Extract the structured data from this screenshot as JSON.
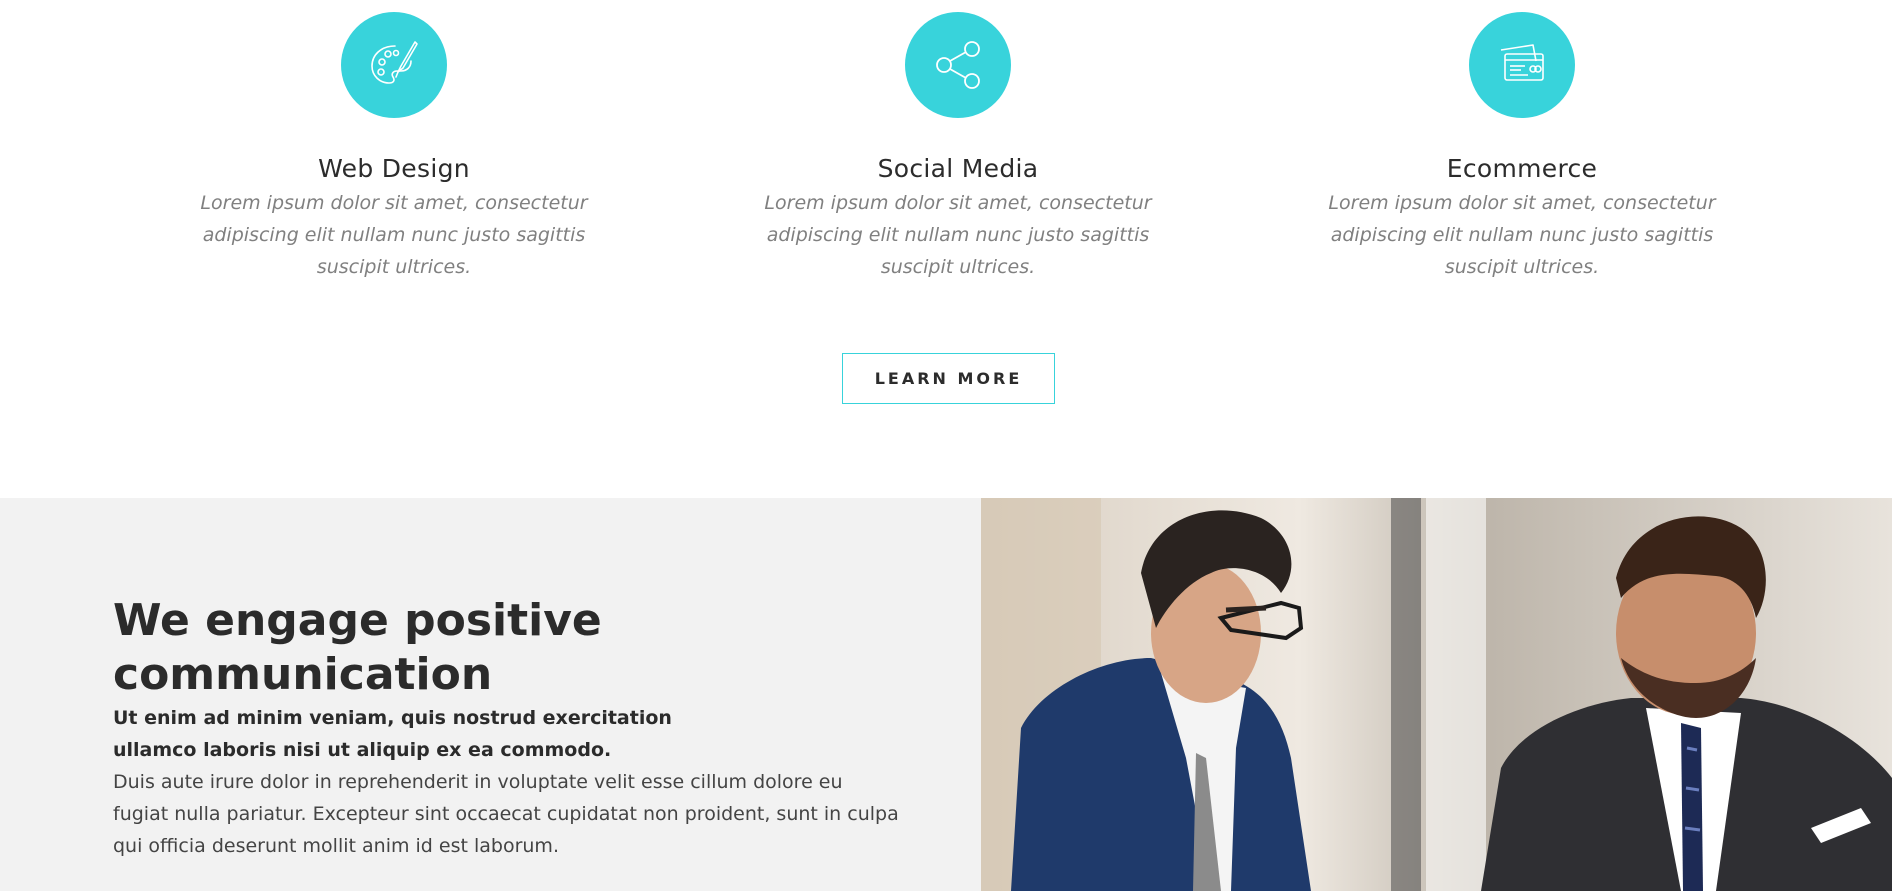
{
  "colors": {
    "accent": "#38d3db",
    "section_bg": "#f2f2f2"
  },
  "services": [
    {
      "icon": "palette-brush-icon",
      "title": "Web Design",
      "description": "Lorem ipsum dolor sit amet, consectetur adipiscing elit nullam nunc justo sagittis suscipit ultrices."
    },
    {
      "icon": "share-icon",
      "title": "Social Media",
      "description": "Lorem ipsum dolor sit amet, consectetur adipiscing elit nullam nunc justo sagittis suscipit ultrices."
    },
    {
      "icon": "credit-cards-icon",
      "title": "Ecommerce",
      "description": "Lorem ipsum dolor sit amet, consectetur adipiscing elit nullam nunc justo sagittis suscipit ultrices."
    }
  ],
  "learn_more_label": "LEARN MORE",
  "about": {
    "title": "We engage positive communication",
    "lead": "Ut enim ad minim veniam, quis nostrud exercitation ullamco laboris nisi ut aliquip ex ea commodo.",
    "body": "Duis aute irure dolor in reprehenderit in voluptate velit esse cillum dolore eu fugiat nulla pariatur. Excepteur sint occaecat cupidatat non proident, sunt in culpa qui officia deserunt mollit anim id est laborum.",
    "photo": "two-businessmen-photo"
  }
}
